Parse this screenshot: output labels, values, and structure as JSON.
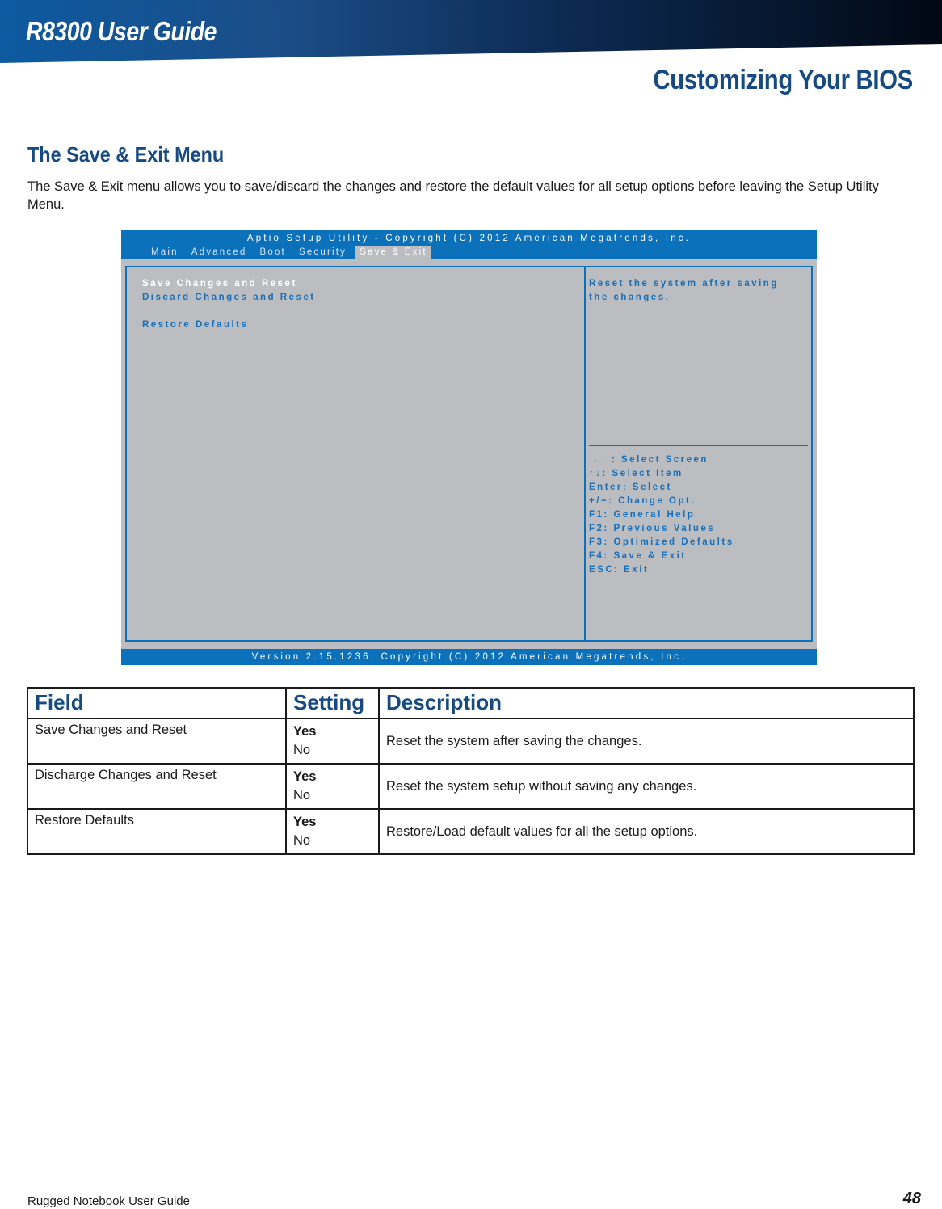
{
  "header": {
    "guide_title": "R8300 User Guide",
    "section_title": "Customizing Your BIOS"
  },
  "content": {
    "heading": "The Save & Exit Menu",
    "intro": "The Save & Exit menu allows you to save/discard the changes and restore the default values for all setup options before leaving the Setup Utility Menu."
  },
  "bios": {
    "title": "Aptio Setup Utility - Copyright (C) 2012 American Megatrends, Inc.",
    "tabs": [
      {
        "label": "Main",
        "active": false
      },
      {
        "label": "Advanced",
        "active": false
      },
      {
        "label": "Boot",
        "active": false
      },
      {
        "label": "Security",
        "active": false
      },
      {
        "label": "Save & Exit",
        "active": true
      }
    ],
    "items": [
      {
        "label": "Save Changes and Reset",
        "selected": true
      },
      {
        "label": "Discard Changes and Reset",
        "selected": false
      },
      {
        "label": "Restore Defaults",
        "selected": false
      }
    ],
    "help_text": [
      "Reset the system after saving",
      "the changes."
    ],
    "keys": [
      {
        "icon": "left-right-arrows-icon",
        "glyph": "→←",
        "label": ": Select Screen"
      },
      {
        "icon": "up-down-arrows-icon",
        "glyph": "↑↓",
        "label": ": Select Item"
      },
      {
        "label": "Enter: Select"
      },
      {
        "label": "+/−: Change Opt."
      },
      {
        "label": "F1: General Help"
      },
      {
        "label": "F2: Previous Values"
      },
      {
        "label": "F3: Optimized Defaults"
      },
      {
        "label": "F4: Save & Exit"
      },
      {
        "label": "ESC: Exit"
      }
    ],
    "footer": "Version 2.15.1236. Copyright (C) 2012 American Megatrends, Inc.",
    "colors": {
      "accent": "#0b71bb",
      "background": "#bcbdc0",
      "text": "#1670bb"
    }
  },
  "table": {
    "headers": [
      "Field",
      "Setting",
      "Description"
    ],
    "rows": [
      {
        "field": "Save Changes and Reset",
        "settings": [
          "Yes",
          "No"
        ],
        "description": "Reset the system after saving the changes."
      },
      {
        "field": "Discharge Changes and Reset",
        "settings": [
          "Yes",
          "No"
        ],
        "description": "Reset the system setup without saving any changes."
      },
      {
        "field": "Restore Defaults",
        "settings": [
          "Yes",
          "No"
        ],
        "description": "Restore/Load default values for all the setup options."
      }
    ]
  },
  "footer": {
    "left": "Rugged Notebook User Guide",
    "page_number": "48"
  },
  "colors": {
    "heading_blue": "#174a83"
  }
}
